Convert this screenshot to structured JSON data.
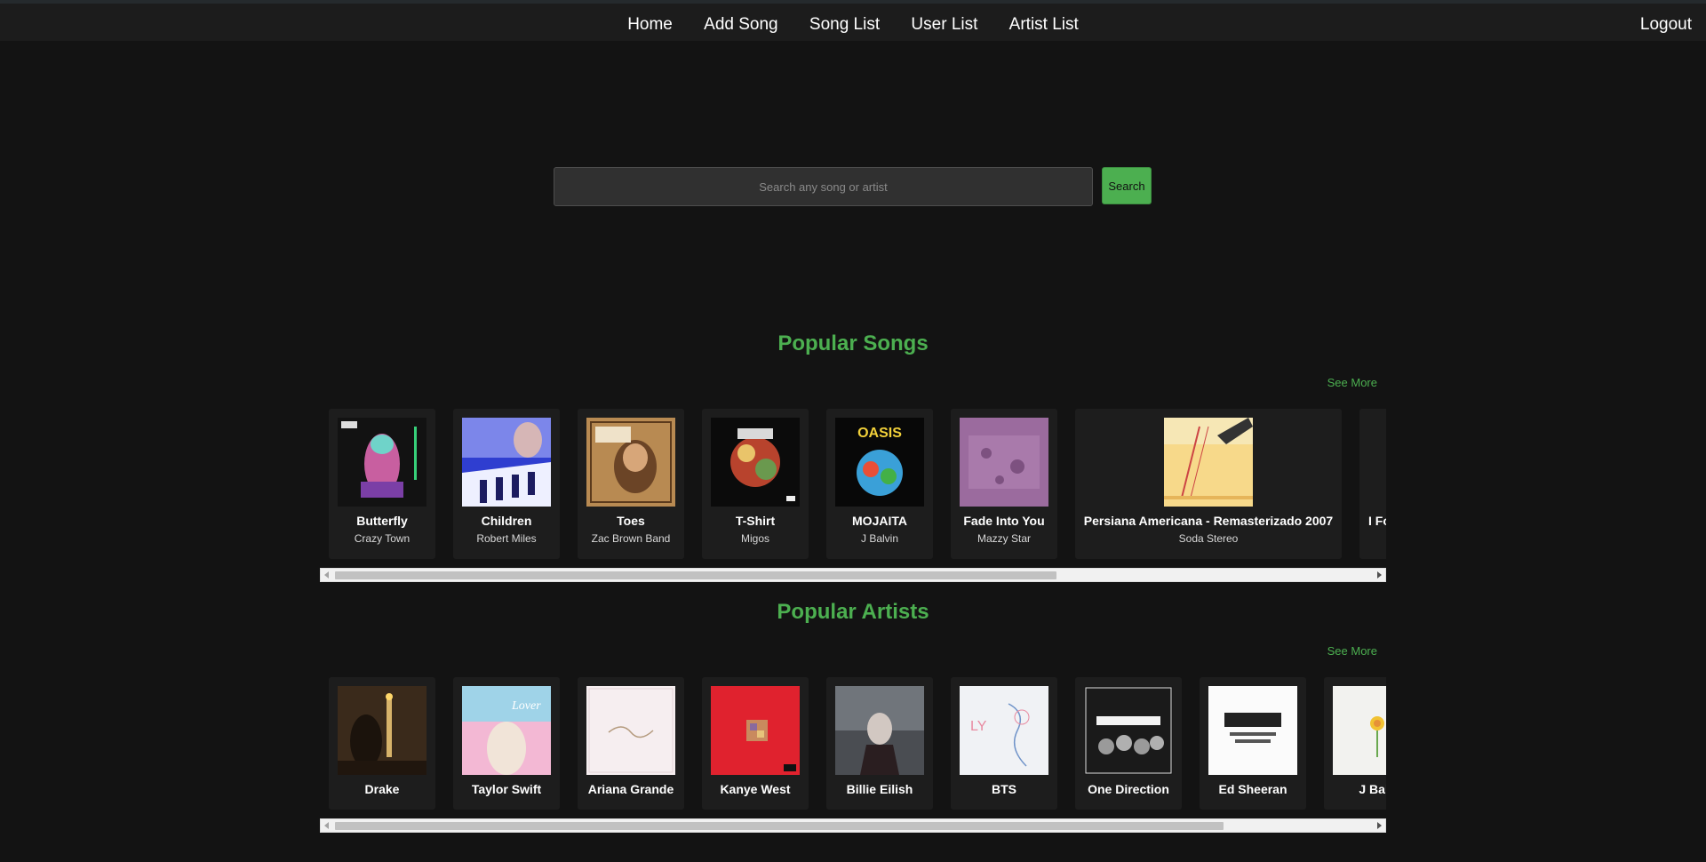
{
  "nav": {
    "items": [
      {
        "label": "Home"
      },
      {
        "label": "Add Song"
      },
      {
        "label": "Song List"
      },
      {
        "label": "User List"
      },
      {
        "label": "Artist List"
      }
    ],
    "logout": "Logout"
  },
  "search": {
    "placeholder": "Search any song or artist",
    "button": "Search"
  },
  "popular_songs": {
    "title": "Popular Songs",
    "see_more": "See More",
    "scroll_position": 0.7,
    "items": [
      {
        "title": "Butterfly",
        "artist": "Crazy Town"
      },
      {
        "title": "Children",
        "artist": "Robert Miles"
      },
      {
        "title": "Toes",
        "artist": "Zac Brown Band"
      },
      {
        "title": "T-Shirt",
        "artist": "Migos"
      },
      {
        "title": "MOJAITA",
        "artist": "J Balvin"
      },
      {
        "title": "Fade Into You",
        "artist": "Mazzy Star"
      },
      {
        "title": "Persiana Americana - Remasterizado 2007",
        "artist": "Soda Stereo"
      },
      {
        "title": "I Fo",
        "artist": ""
      }
    ]
  },
  "popular_artists": {
    "title": "Popular Artists",
    "see_more": "See More",
    "scroll_position": 0.85,
    "items": [
      {
        "name": "Drake"
      },
      {
        "name": "Taylor Swift"
      },
      {
        "name": "Ariana Grande"
      },
      {
        "name": "Kanye West"
      },
      {
        "name": "Billie Eilish"
      },
      {
        "name": "BTS"
      },
      {
        "name": "One Direction"
      },
      {
        "name": "Ed Sheeran"
      },
      {
        "name": "J Balv"
      }
    ]
  },
  "colors": {
    "accent": "#4caf50",
    "background": "#131313",
    "card": "#1d1d1d",
    "topbar": "#1c1c1c"
  }
}
